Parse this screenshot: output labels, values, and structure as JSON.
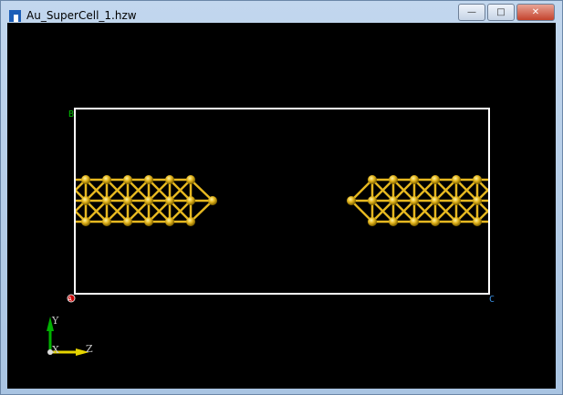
{
  "window": {
    "title": "Au_SuperCell_1.hzw",
    "minimize": "—",
    "maximize": "□",
    "close": "✕"
  },
  "cell": {
    "label_a": "A",
    "label_b": "B",
    "label_c": "C",
    "edge_color": "#ffffff"
  },
  "axes": {
    "y": "Y",
    "x": "X",
    "z": "Z",
    "y_color": "#00b000",
    "z_color": "#e6d400"
  },
  "atoms": {
    "element": "Au",
    "color": "#e6b820",
    "left_columns": 6,
    "right_columns": 6,
    "rows": 3
  }
}
